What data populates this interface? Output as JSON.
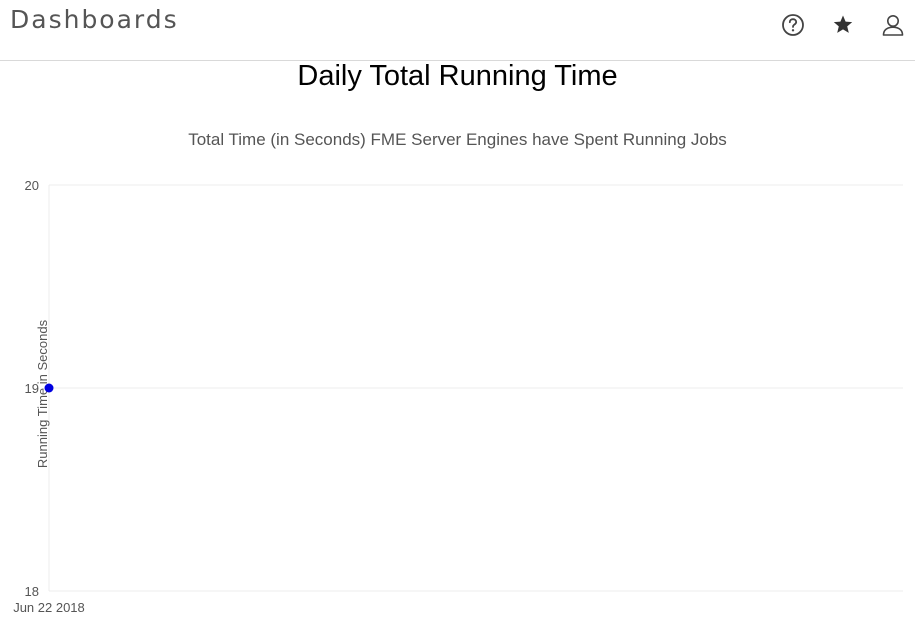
{
  "header": {
    "title": "Dashboards",
    "icons": [
      "question-circle-icon",
      "star-icon",
      "user-icon"
    ]
  },
  "colors": {
    "point": "#0000e0",
    "grid": "#ececec",
    "text": "#555555"
  },
  "chart_data": {
    "type": "line",
    "title": "Daily Total Running Time",
    "subtitle": "Total Time (in Seconds) FME Server Engines have Spent Running Jobs",
    "xlabel": "",
    "ylabel": "Running Time in Seconds",
    "x_ticks": [
      "Jun 22 2018"
    ],
    "y_ticks": [
      18,
      19,
      20
    ],
    "ylim": [
      18,
      20
    ],
    "grid": true,
    "series": [
      {
        "x": [
          "Jun 22 2018"
        ],
        "values": [
          19
        ]
      }
    ]
  }
}
